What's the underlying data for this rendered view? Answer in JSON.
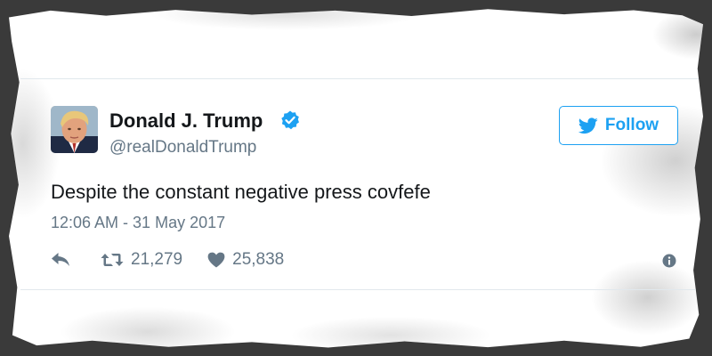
{
  "tweet": {
    "display_name": "Donald J. Trump",
    "handle": "@realDonaldTrump",
    "text": "Despite the constant negative press covfefe",
    "timestamp": "12:06 AM - 31 May 2017",
    "retweet_count": "21,279",
    "like_count": "25,838",
    "follow_label": "Follow"
  },
  "icons": {
    "verified": "verified-badge-icon",
    "follow": "twitter-bird-icon",
    "reply": "reply-icon",
    "retweet": "retweet-icon",
    "like": "heart-icon",
    "info": "info-icon"
  },
  "colors": {
    "accent": "#1da1f2",
    "text": "#14171a",
    "secondary": "#657786",
    "border": "#e1e8ed"
  }
}
